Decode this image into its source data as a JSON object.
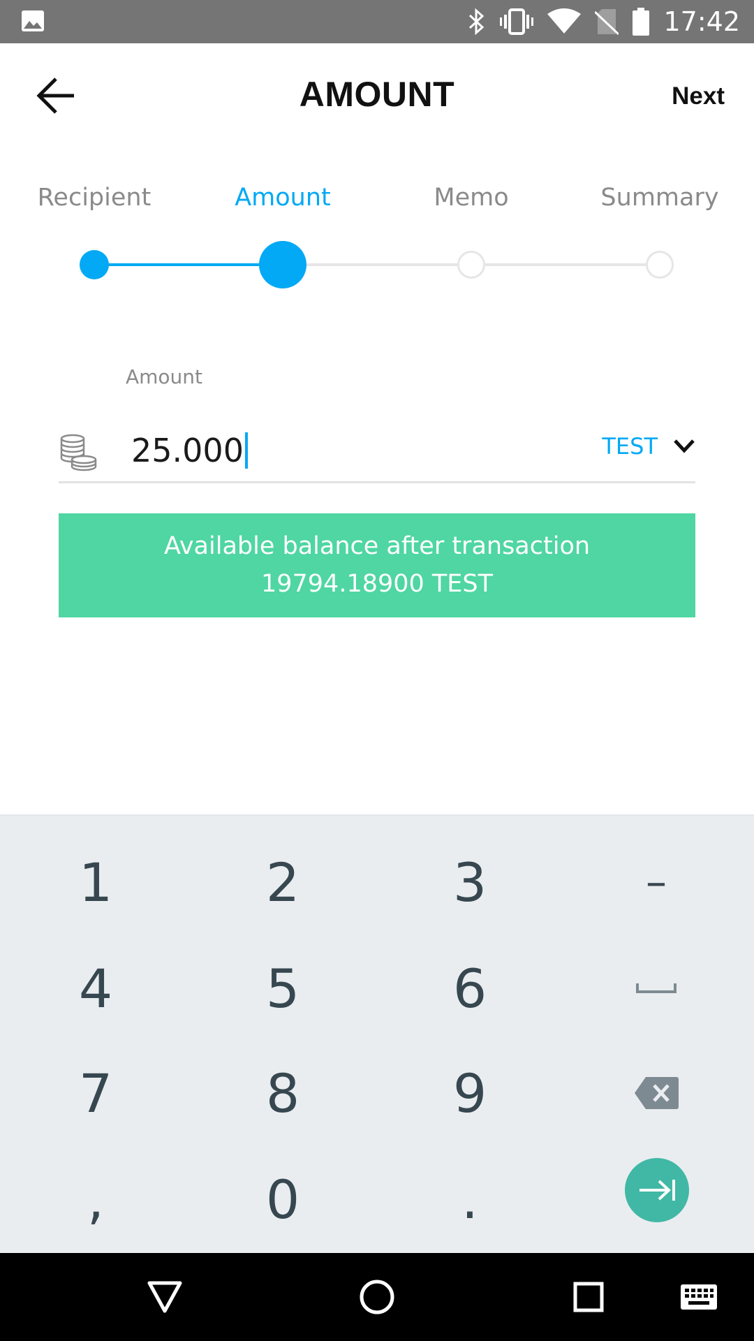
{
  "status_bar": {
    "time": "17:42",
    "icons": [
      "gallery-icon",
      "bluetooth-icon",
      "vibrate-icon",
      "wifi-icon",
      "no-sim-icon",
      "battery-icon"
    ]
  },
  "app_bar": {
    "title": "AMOUNT",
    "next_label": "Next",
    "back_icon": "arrow-left-icon"
  },
  "stepper": {
    "steps": [
      {
        "label": "Recipient",
        "state": "done"
      },
      {
        "label": "Amount",
        "state": "active"
      },
      {
        "label": "Memo",
        "state": "pending"
      },
      {
        "label": "Summary",
        "state": "pending"
      }
    ],
    "accent_color": "#03a9f4"
  },
  "amount_field": {
    "label": "Amount",
    "value": "25.000",
    "currency": "TEST",
    "icon": "coins-icon"
  },
  "balance_banner": {
    "line1": "Available balance after transaction",
    "line2": "19794.18900 TEST",
    "color": "#4fd6a2"
  },
  "keyboard": {
    "rows": [
      [
        "1",
        "2",
        "3",
        "–"
      ],
      [
        "4",
        "5",
        "6",
        "␣"
      ],
      [
        "7",
        "8",
        "9",
        "⌫"
      ],
      [
        ",",
        "0",
        ".",
        "⇥"
      ]
    ],
    "enter_color": "#40b8a5"
  },
  "nav_bar": {
    "buttons": [
      "back-triangle-icon",
      "home-circle-icon",
      "recents-square-icon",
      "keyboard-icon"
    ]
  }
}
